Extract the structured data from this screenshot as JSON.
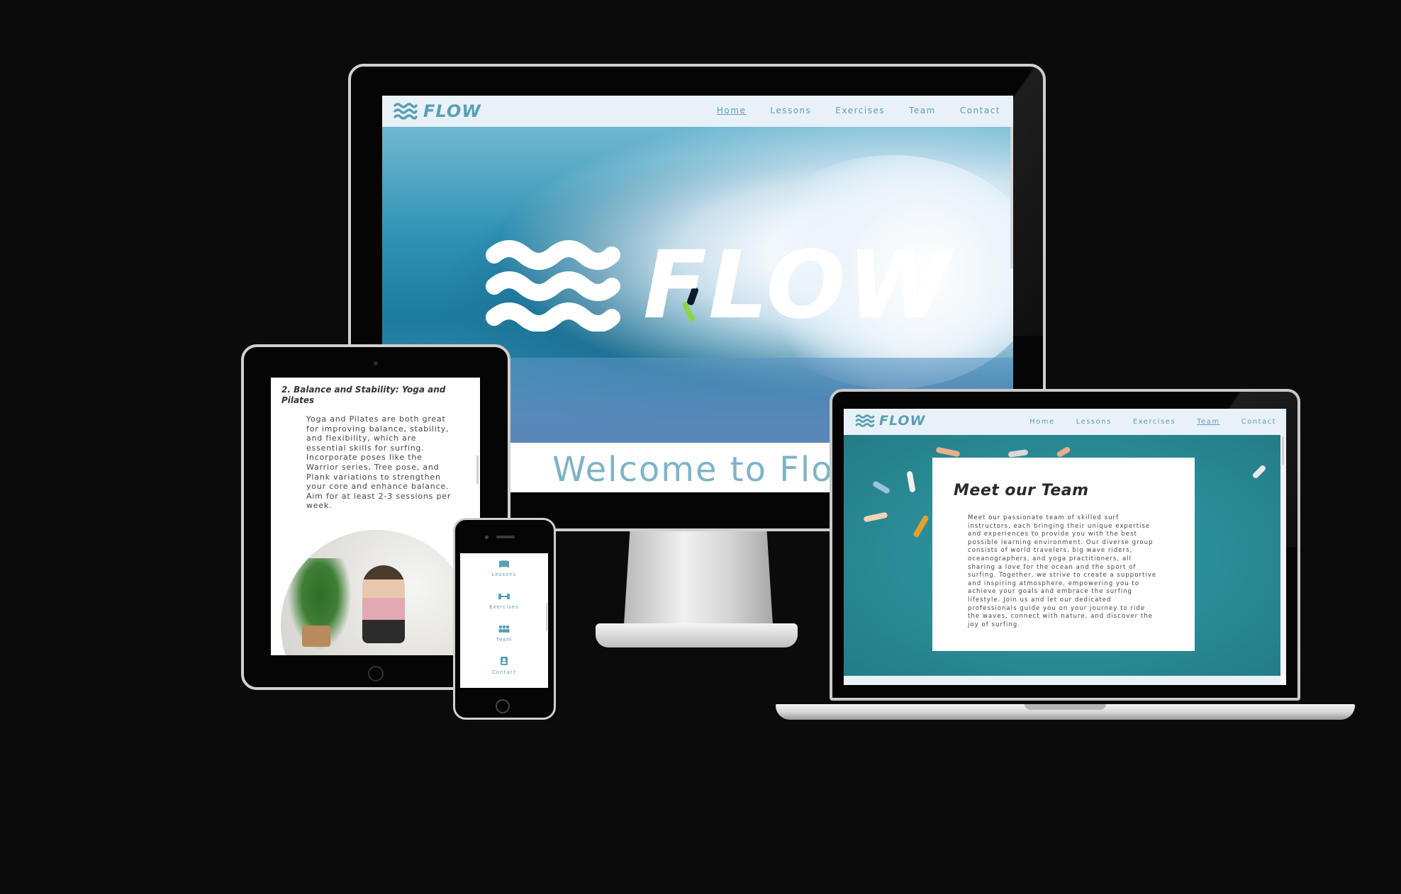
{
  "brand": {
    "name": "FLOW"
  },
  "colors": {
    "accent": "#5a9fb3",
    "nav_bg": "#e9f1f8",
    "ocean": "#2a9aa2",
    "background": "#0b0b0b"
  },
  "desktop": {
    "nav": {
      "links": [
        {
          "label": "Home",
          "active": true
        },
        {
          "label": "Lessons",
          "active": false
        },
        {
          "label": "Exercises",
          "active": false
        },
        {
          "label": "Team",
          "active": false
        },
        {
          "label": "Contact",
          "active": false
        }
      ]
    },
    "hero": {
      "logo_text": "FLOW"
    },
    "welcome_heading": "Welcome to Flow"
  },
  "tablet": {
    "section_heading": "2. Balance and Stability: Yoga and Pilates",
    "section_body": "Yoga and Pilates are both great for improving balance, stability, and flexibility, which are essential skills for surfing. Incorporate poses like the Warrior series, Tree pose, and Plank variations to strengthen your core and enhance balance. Aim for at least 2-3 sessions per week."
  },
  "phone": {
    "menu": [
      {
        "label": "Lessons",
        "icon": "book-icon"
      },
      {
        "label": "Exercises",
        "icon": "dumbbell-icon"
      },
      {
        "label": "Team",
        "icon": "people-icon"
      },
      {
        "label": "Contact",
        "icon": "contact-card-icon"
      }
    ]
  },
  "laptop": {
    "nav": {
      "links": [
        {
          "label": "Home",
          "active": false
        },
        {
          "label": "Lessons",
          "active": false
        },
        {
          "label": "Exercises",
          "active": false
        },
        {
          "label": "Team",
          "active": true
        },
        {
          "label": "Contact",
          "active": false
        }
      ]
    },
    "team_card": {
      "title": "Meet our Team",
      "body": "Meet our passionate team of skilled surf instructors, each bringing their unique expertise and experiences to provide you with the best possible learning environment. Our diverse group consists of world travelers, big wave riders, oceanographers, and yoga practitioners, all sharing a love for the ocean and the sport of surfing. Together, we strive to create a supportive and inspiring atmosphere, empowering you to achieve your goals and embrace the surfing lifestyle. Join us and let our dedicated professionals guide you on your journey to ride the waves, connect with nature, and discover the joy of surfing."
    }
  }
}
